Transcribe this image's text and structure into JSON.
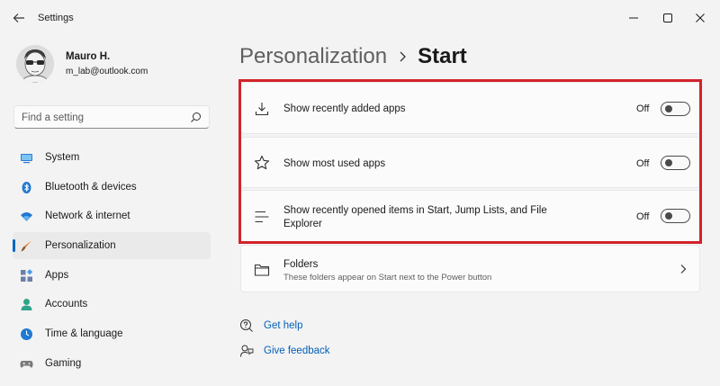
{
  "window": {
    "title": "Settings"
  },
  "profile": {
    "name": "Mauro H.",
    "email": "m_lab@outlook.com"
  },
  "search": {
    "placeholder": "Find a setting"
  },
  "nav": {
    "items": [
      {
        "label": "System",
        "icon": "system-icon"
      },
      {
        "label": "Bluetooth & devices",
        "icon": "bluetooth-icon"
      },
      {
        "label": "Network & internet",
        "icon": "wifi-icon"
      },
      {
        "label": "Personalization",
        "icon": "brush-icon",
        "active": true
      },
      {
        "label": "Apps",
        "icon": "apps-icon"
      },
      {
        "label": "Accounts",
        "icon": "accounts-icon"
      },
      {
        "label": "Time & language",
        "icon": "clock-globe-icon"
      },
      {
        "label": "Gaming",
        "icon": "gamepad-icon"
      }
    ]
  },
  "breadcrumb": {
    "parent": "Personalization",
    "current": "Start"
  },
  "settings": {
    "recently_added": {
      "label": "Show recently added apps",
      "state": "Off"
    },
    "most_used": {
      "label": "Show most used apps",
      "state": "Off"
    },
    "recently_opened": {
      "label_line1": "Show recently opened items in Start, Jump Lists, and File",
      "label_line2": "Explorer",
      "state": "Off"
    },
    "folders": {
      "label": "Folders",
      "description": "These folders appear on Start next to the Power button"
    }
  },
  "help": {
    "get_help": "Get help",
    "give_feedback": "Give feedback"
  },
  "colors": {
    "accent": "#0067c0",
    "highlight_border": "#d2232a",
    "link": "#0060b8"
  }
}
